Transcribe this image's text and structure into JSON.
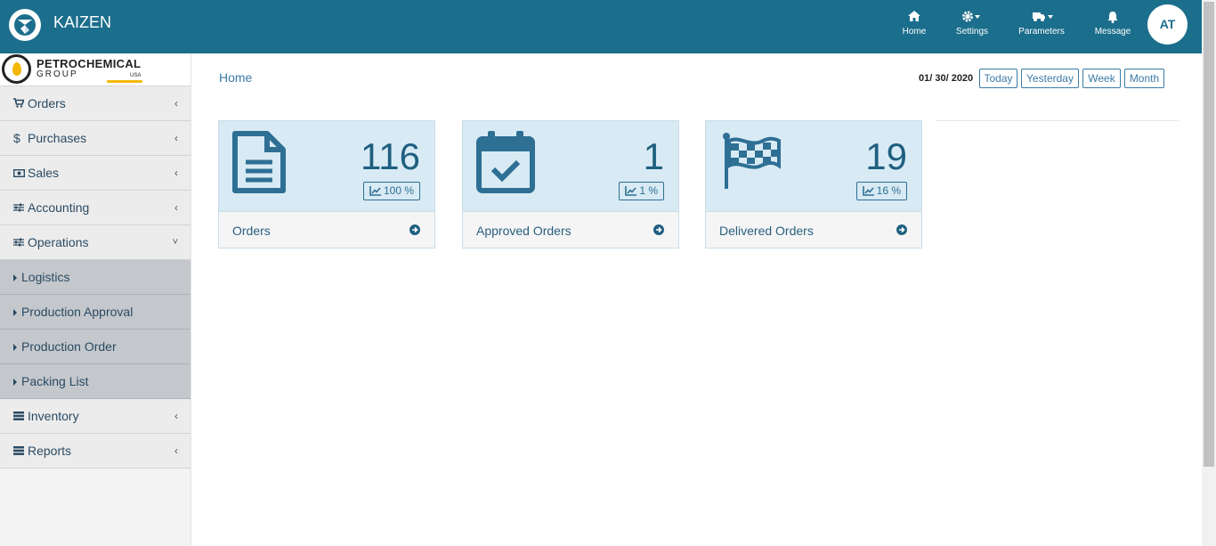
{
  "header": {
    "title": "KAIZEN",
    "nav": [
      {
        "label": "Home",
        "icon": "home-icon"
      },
      {
        "label": "Settings",
        "icon": "gear-icon"
      },
      {
        "label": "Parameters",
        "icon": "truck-icon"
      },
      {
        "label": "Message",
        "icon": "bell-icon"
      }
    ],
    "avatar": "AT"
  },
  "sidebar": {
    "brand": {
      "line1": "PETROCHEMICAL",
      "line2": "GROUP",
      "line3": "USA"
    },
    "items": [
      {
        "label": "Orders",
        "icon": "cart-icon"
      },
      {
        "label": "Purchases",
        "icon": "dollar-icon"
      },
      {
        "label": "Sales",
        "icon": "money-icon"
      },
      {
        "label": "Accounting",
        "icon": "sliders-icon"
      },
      {
        "label": "Operations",
        "icon": "sliders-icon",
        "expanded": true
      },
      {
        "label": "Inventory",
        "icon": "server-icon"
      },
      {
        "label": "Reports",
        "icon": "server-icon"
      }
    ],
    "operations_sub": [
      {
        "label": "Logistics"
      },
      {
        "label": "Production Approval"
      },
      {
        "label": "Production Order"
      },
      {
        "label": "Packing List"
      }
    ]
  },
  "main": {
    "breadcrumb": "Home",
    "date": "01/ 30/ 2020",
    "ranges": [
      "Today",
      "Yesterday",
      "Week",
      "Month"
    ],
    "cards": [
      {
        "value": "116",
        "percent": "100 %",
        "label": "Orders",
        "icon": "file-icon"
      },
      {
        "value": "1",
        "percent": "1 %",
        "label": "Approved Orders",
        "icon": "calendar-check-icon"
      },
      {
        "value": "19",
        "percent": "16 %",
        "label": "Delivered Orders",
        "icon": "flag-checkered-icon"
      }
    ]
  },
  "colors": {
    "primary": "#1b6e8c",
    "card_bg": "#d8eaf4",
    "accent": "#3a7ba7"
  }
}
